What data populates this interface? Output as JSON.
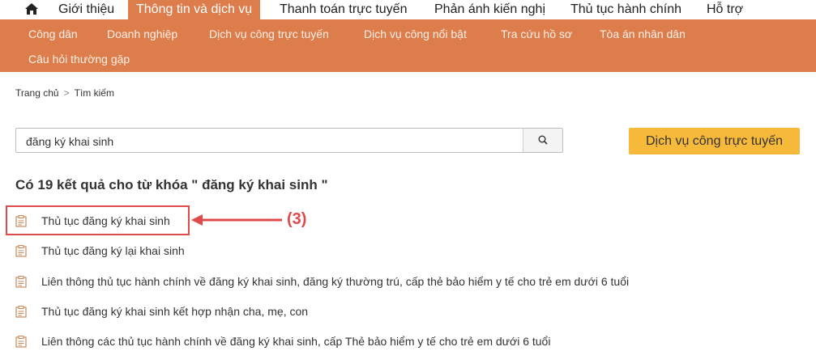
{
  "topnav": {
    "items": [
      {
        "label": "Giới thiệu",
        "active": false
      },
      {
        "label": "Thông tin và dịch vụ",
        "active": true
      },
      {
        "label": "Thanh toán trực tuyến",
        "active": false
      },
      {
        "label": "Phản ánh kiến nghị",
        "active": false
      },
      {
        "label": "Thủ tục hành chính",
        "active": false
      },
      {
        "label": "Hỗ trợ",
        "active": false
      }
    ]
  },
  "subnav": {
    "items": [
      {
        "label": "Công dân"
      },
      {
        "label": "Doanh nghiệp"
      },
      {
        "label": "Dịch vụ công trực tuyến"
      },
      {
        "label": "Dịch vụ công nổi bật"
      },
      {
        "label": "Tra cứu hồ sơ"
      },
      {
        "label": "Tòa án nhân dân"
      },
      {
        "label": "Câu hỏi thường gặp"
      }
    ]
  },
  "breadcrumb": {
    "home": "Trang chủ",
    "separator": ">",
    "current": "Tìm kiếm"
  },
  "search": {
    "value": "đăng ký khai sinh"
  },
  "online_service_button": "Dịch vụ công trực tuyến",
  "results": {
    "heading": "Có 19 kết quả cho từ khóa \" đăng ký khai sinh \"",
    "items": [
      {
        "label": "Thủ tục đăng ký khai sinh"
      },
      {
        "label": "Thủ tục đăng ký lại khai sinh"
      },
      {
        "label": "Liên thông thủ tục hành chính về đăng ký khai sinh, đăng ký thường trú, cấp thẻ bảo hiểm y tế cho trẻ em dưới 6 tuổi"
      },
      {
        "label": "Thủ tục đăng ký khai sinh kết hợp nhận cha, mẹ, con"
      },
      {
        "label": "Liên thông các thủ tục hành chính về đăng ký khai sinh, cấp Thẻ bảo hiểm y tế cho trẻ em dưới 6 tuổi"
      }
    ]
  },
  "annotation": {
    "callout": "(3)",
    "color": "#e04a4a"
  },
  "colors": {
    "nav_accent": "#dd7d4c",
    "button_yellow": "#f7b93a"
  },
  "icons": {
    "home": "home-icon",
    "search": "search-icon",
    "result": "document-icon"
  }
}
